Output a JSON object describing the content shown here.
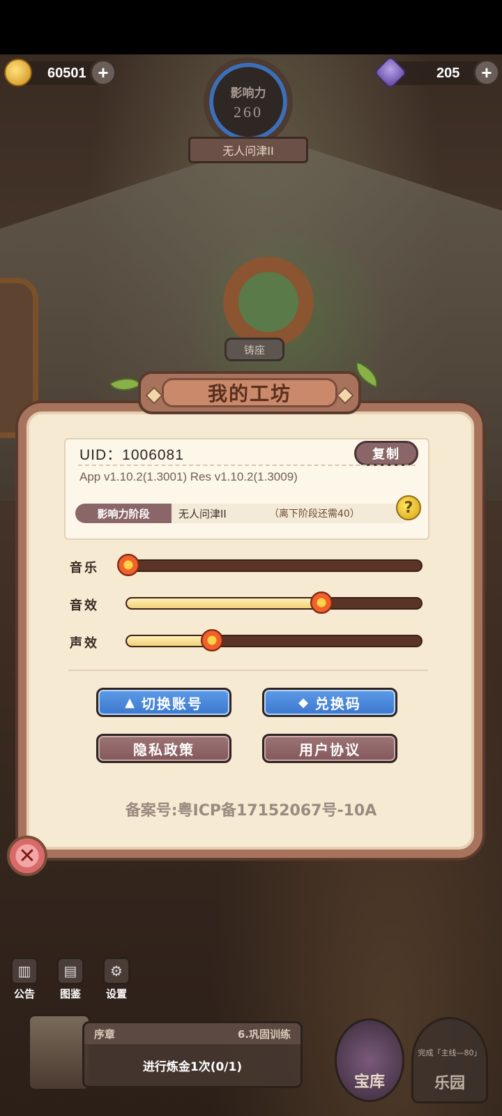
{
  "top_bar": {
    "coins": "60501",
    "gems": "205",
    "influence_label": "影响力",
    "influence_value": "260",
    "rank": "无人问津II"
  },
  "scene": {
    "locked_label": "铸座"
  },
  "dialog": {
    "title": "我的工坊",
    "uid_text": "UID：1006081",
    "copy_label": "复制",
    "version_text": "App v1.10.2(1.3001)  Res v1.10.2(1.3009)",
    "stage_label": "影响力阶段",
    "stage_name": "无人问津II",
    "stage_need": "（离下阶段还需40）",
    "hint_glyph": "?",
    "sliders": [
      {
        "label": "音乐",
        "level": 0.0
      },
      {
        "label": "音效",
        "level": 0.66
      },
      {
        "label": "声效",
        "level": 0.29
      }
    ],
    "buttons": {
      "switch_account": "切换账号",
      "redeem_code": "兑换码",
      "privacy_policy": "隐私政策",
      "user_agreement": "用户协议"
    },
    "icp": "备案号:粤ICP备17152067号-10A",
    "close_glyph": "✕"
  },
  "bottom": {
    "icons": [
      {
        "label": "公告",
        "icon": "notice-board-icon",
        "glyph": "▥"
      },
      {
        "label": "图鉴",
        "icon": "catalog-book-icon",
        "glyph": "▤"
      },
      {
        "label": "设置",
        "icon": "gear-icon",
        "glyph": "⚙"
      }
    ],
    "quest_chapter": "序章",
    "quest_step": "6.巩固训练",
    "quest_task": "进行炼金1次(0/1)",
    "store_label": "宝库",
    "locked_feature_hint": "完成「主线—80」",
    "locked_feature_label": "乐园"
  }
}
